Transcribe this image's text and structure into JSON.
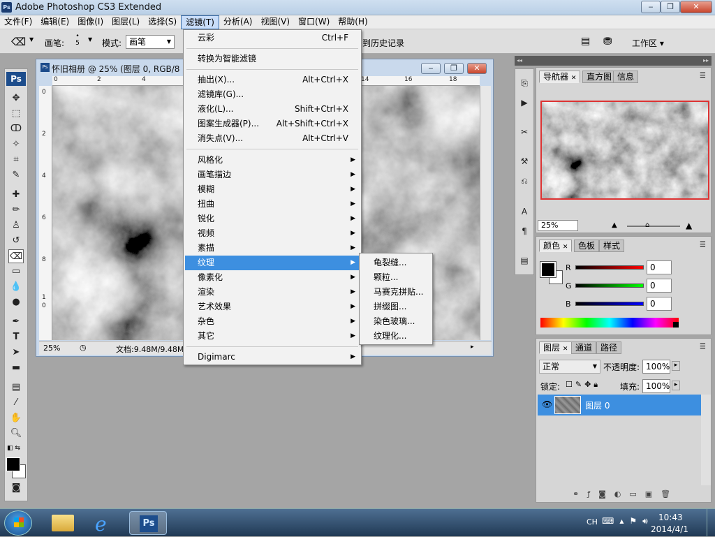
{
  "app": {
    "title": "Adobe Photoshop CS3 Extended",
    "logo": "Ps"
  },
  "menubar": [
    "文件(F)",
    "编辑(E)",
    "图像(I)",
    "图层(L)",
    "选择(S)",
    "滤镜(T)",
    "分析(A)",
    "视图(V)",
    "窗口(W)",
    "帮助(H)"
  ],
  "options": {
    "brush_label": "画笔:",
    "brush_size": "5",
    "mode_label": "模式:",
    "mode_value": "画笔",
    "history_text": "到历史记录",
    "workspace": "工作区"
  },
  "document": {
    "title": "怀旧相册 @ 25% (图层 0, RGB/8",
    "zoom": "25%",
    "status": "文档:9.48M/9.48M",
    "ruler_top": [
      "0",
      "2",
      "4",
      "14",
      "16",
      "18"
    ],
    "ruler_left": [
      "0",
      "2",
      "4",
      "6",
      "8",
      "1",
      "0"
    ]
  },
  "filter_menu": {
    "items": [
      {
        "label": "云彩",
        "shortcut": "Ctrl+F"
      },
      {
        "label": "转换为智能滤镜",
        "shortcut": ""
      },
      {
        "label": "抽出(X)...",
        "shortcut": "Alt+Ctrl+X"
      },
      {
        "label": "滤镜库(G)...",
        "shortcut": ""
      },
      {
        "label": "液化(L)...",
        "shortcut": "Shift+Ctrl+X"
      },
      {
        "label": "图案生成器(P)...",
        "shortcut": "Alt+Shift+Ctrl+X"
      },
      {
        "label": "消失点(V)...",
        "shortcut": "Alt+Ctrl+V"
      },
      {
        "label": "风格化"
      },
      {
        "label": "画笔描边"
      },
      {
        "label": "模糊"
      },
      {
        "label": "扭曲"
      },
      {
        "label": "锐化"
      },
      {
        "label": "视频"
      },
      {
        "label": "素描"
      },
      {
        "label": "纹理"
      },
      {
        "label": "像素化"
      },
      {
        "label": "渲染"
      },
      {
        "label": "艺术效果"
      },
      {
        "label": "杂色"
      },
      {
        "label": "其它"
      },
      {
        "label": "Digimarc"
      }
    ],
    "submenu": [
      "龟裂缝...",
      "颗粒...",
      "马赛克拼贴...",
      "拼缀图...",
      "染色玻璃...",
      "纹理化..."
    ]
  },
  "navigator": {
    "tabs": [
      "导航器",
      "直方图",
      "信息"
    ],
    "zoom": "25%"
  },
  "color": {
    "tabs": [
      "颜色",
      "色板",
      "样式"
    ],
    "channels": [
      {
        "name": "R",
        "value": "0"
      },
      {
        "name": "G",
        "value": "0"
      },
      {
        "name": "B",
        "value": "0"
      }
    ]
  },
  "layers": {
    "tabs": [
      "图层",
      "通道",
      "路径"
    ],
    "blend_mode": "正常",
    "opacity_label": "不透明度:",
    "opacity": "100%",
    "lock_label": "锁定:",
    "fill_label": "填充:",
    "fill": "100%",
    "layer_name": "图层 0"
  },
  "taskbar": {
    "lang": "CH",
    "time": "10:43",
    "date": "2014/4/1"
  },
  "colors": {
    "menu_highlight": "#3d8fe0",
    "layer_selected": "#3d8fe0",
    "nav_frame": "#dd3333"
  }
}
